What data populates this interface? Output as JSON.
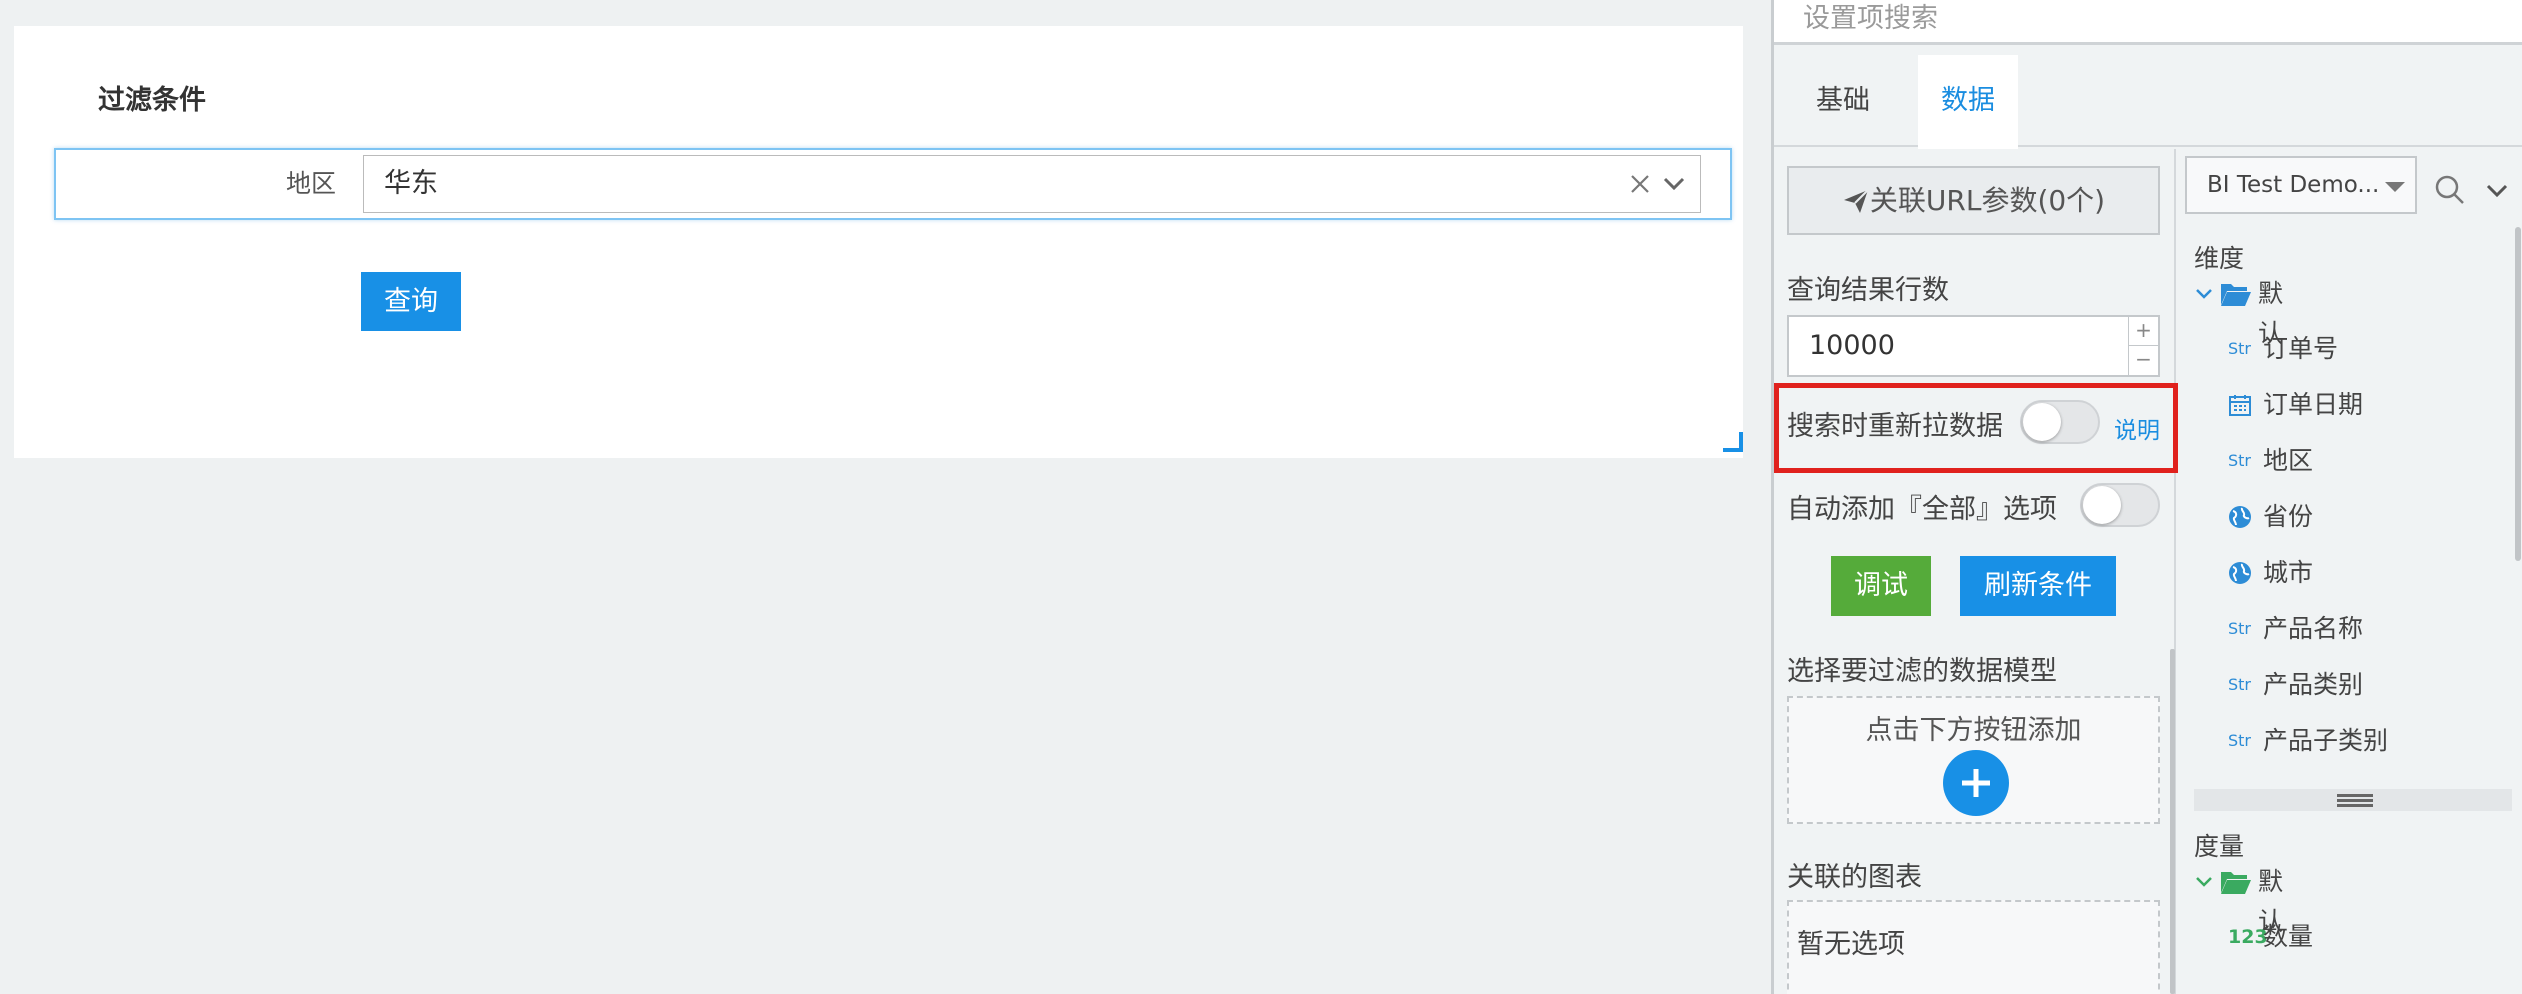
{
  "canvas": {
    "filter_title": "过滤条件",
    "region_label": "地区",
    "region_value": "华东",
    "query_button": "查询"
  },
  "panel": {
    "search_placeholder": "设置项搜索",
    "tabs": [
      {
        "label": "基础",
        "active": false
      },
      {
        "label": "数据",
        "active": true
      }
    ],
    "url_button": "关联URL参数(0个)",
    "rows_label": "查询结果行数",
    "rows_value": "10000",
    "stepper_plus": "+",
    "stepper_minus": "−",
    "refetch_label": "搜索时重新拉数据",
    "refetch_on": false,
    "explain_link": "说明",
    "auto_all_label": "自动添加『全部』选项",
    "auto_all_on": false,
    "debug_button": "调试",
    "refresh_button": "刷新条件",
    "model_label": "选择要过滤的数据模型",
    "model_hint": "点击下方按钮添加",
    "charts_label": "关联的图表",
    "charts_empty": "暂无选项"
  },
  "fields": {
    "datasource": "BI Test Demo...",
    "dimension_title": "维度",
    "dimension_folder": "默认",
    "dimensions": [
      {
        "type": "Str",
        "icon": "string-type-icon",
        "label": "订单号"
      },
      {
        "type": "date",
        "icon": "calendar-icon",
        "label": "订单日期"
      },
      {
        "type": "Str",
        "icon": "string-type-icon",
        "label": "地区"
      },
      {
        "type": "geo",
        "icon": "globe-icon",
        "label": "省份"
      },
      {
        "type": "geo",
        "icon": "globe-icon",
        "label": "城市"
      },
      {
        "type": "Str",
        "icon": "string-type-icon",
        "label": "产品名称"
      },
      {
        "type": "Str",
        "icon": "string-type-icon",
        "label": "产品类别"
      },
      {
        "type": "Str",
        "icon": "string-type-icon",
        "label": "产品子类别"
      }
    ],
    "measure_title": "度量",
    "measure_folder": "默认",
    "measures": [
      {
        "type": "123",
        "icon": "number-type-icon",
        "label": "数量"
      }
    ]
  },
  "colors": {
    "accent": "#1890e6",
    "success": "#55ab3a",
    "highlight": "#e0211d"
  }
}
